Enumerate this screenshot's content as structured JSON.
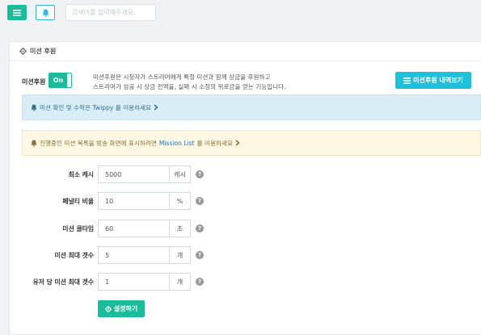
{
  "topbar": {
    "search_placeholder": "검색어를 입력해주세요.",
    "accent_color": "#1bbc9b",
    "bell_border_color": "#2fb8e0"
  },
  "panel": {
    "title": "미션 후원"
  },
  "mission_toggle": {
    "label": "미션후원",
    "state": "On",
    "description_line1": "미션후원은 시청자가 스트리머에게 특정 미션과 함께 상금을 후원하고",
    "description_line2": "스트리머가 성공 시 상금 전액을, 실패 시 소정의 위로금을 얻는 기능입니다.",
    "history_button": "미션후원 내역보기"
  },
  "alerts": {
    "info": {
      "text": "미션 확인 및 수락은 Twippy 를 이용하세요",
      "color": "#d9edf7"
    },
    "warning": {
      "text_before": "진행중인 미션 목록을 방송 화면에 표시하려면",
      "link": "Mission List",
      "text_after": "를 이용하세요",
      "color": "#fcf8e3"
    }
  },
  "form": {
    "fields": [
      {
        "label": "최소 캐시",
        "value": "5000",
        "unit": "캐시"
      },
      {
        "label": "페널티 비율",
        "value": "10",
        "unit": "%"
      },
      {
        "label": "미션 쿨타임",
        "value": "60",
        "unit": "초"
      },
      {
        "label": "미션 최대 갯수",
        "value": "5",
        "unit": "개"
      },
      {
        "label": "유저 당 미션 최대 갯수",
        "value": "1",
        "unit": "개"
      }
    ],
    "help_glyph": "?",
    "save_button": "설정하기"
  }
}
